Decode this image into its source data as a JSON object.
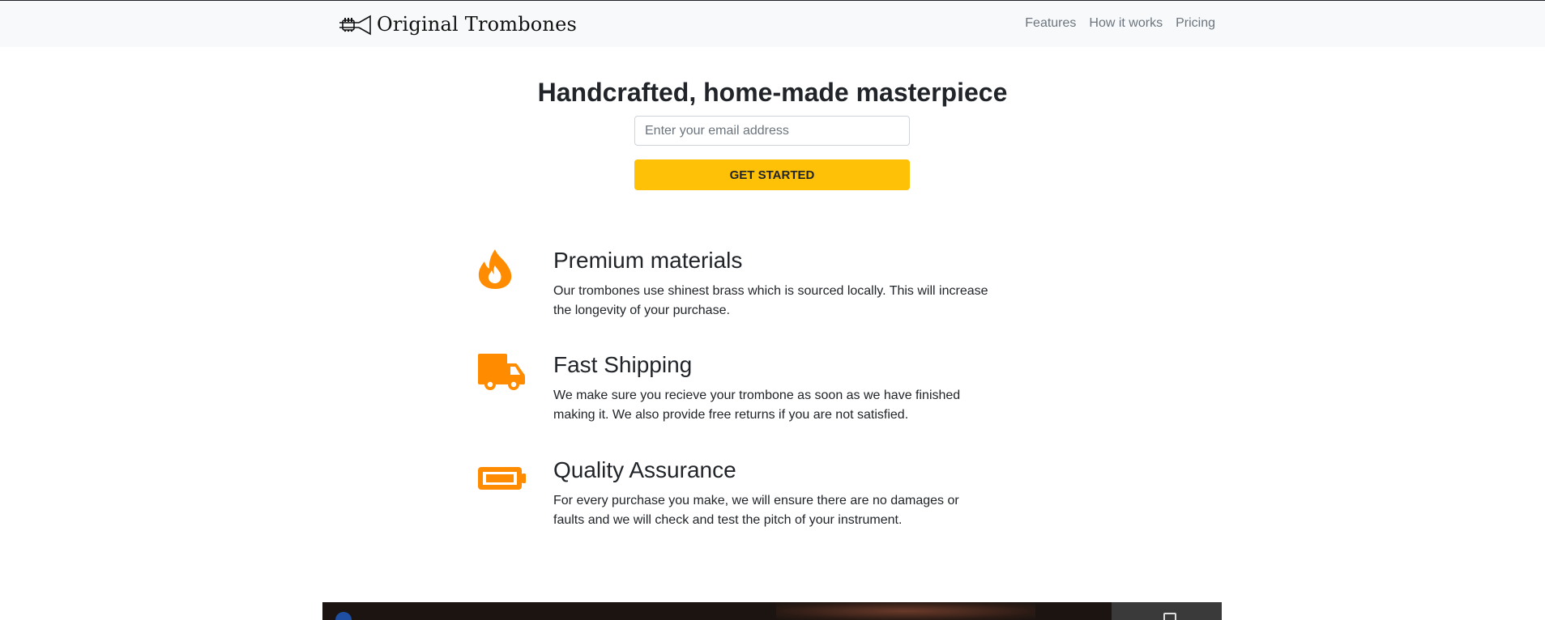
{
  "navbar": {
    "brand": "Original Trombones",
    "links": [
      "Features",
      "How it works",
      "Pricing"
    ]
  },
  "hero": {
    "title": "Handcrafted, home-made masterpiece",
    "email_placeholder": "Enter your email address",
    "cta_label": "GET STARTED"
  },
  "features": [
    {
      "icon": "fire-icon",
      "title": "Premium materials",
      "text": "Our trombones use shinest brass which is sourced locally. This will increase the longevity of your purchase."
    },
    {
      "icon": "truck-icon",
      "title": "Fast Shipping",
      "text": "We make sure you recieve your trombone as soon as we have finished making it. We also provide free returns if you are not satisfied."
    },
    {
      "icon": "battery-icon",
      "title": "Quality Assurance",
      "text": "For every purchase you make, we will ensure there are no damages or faults and we will check and test the pitch of your instrument."
    }
  ],
  "colors": {
    "accent": "#ffc107",
    "icon": "#ff8c00",
    "navbar_bg": "#f8f9fa"
  }
}
